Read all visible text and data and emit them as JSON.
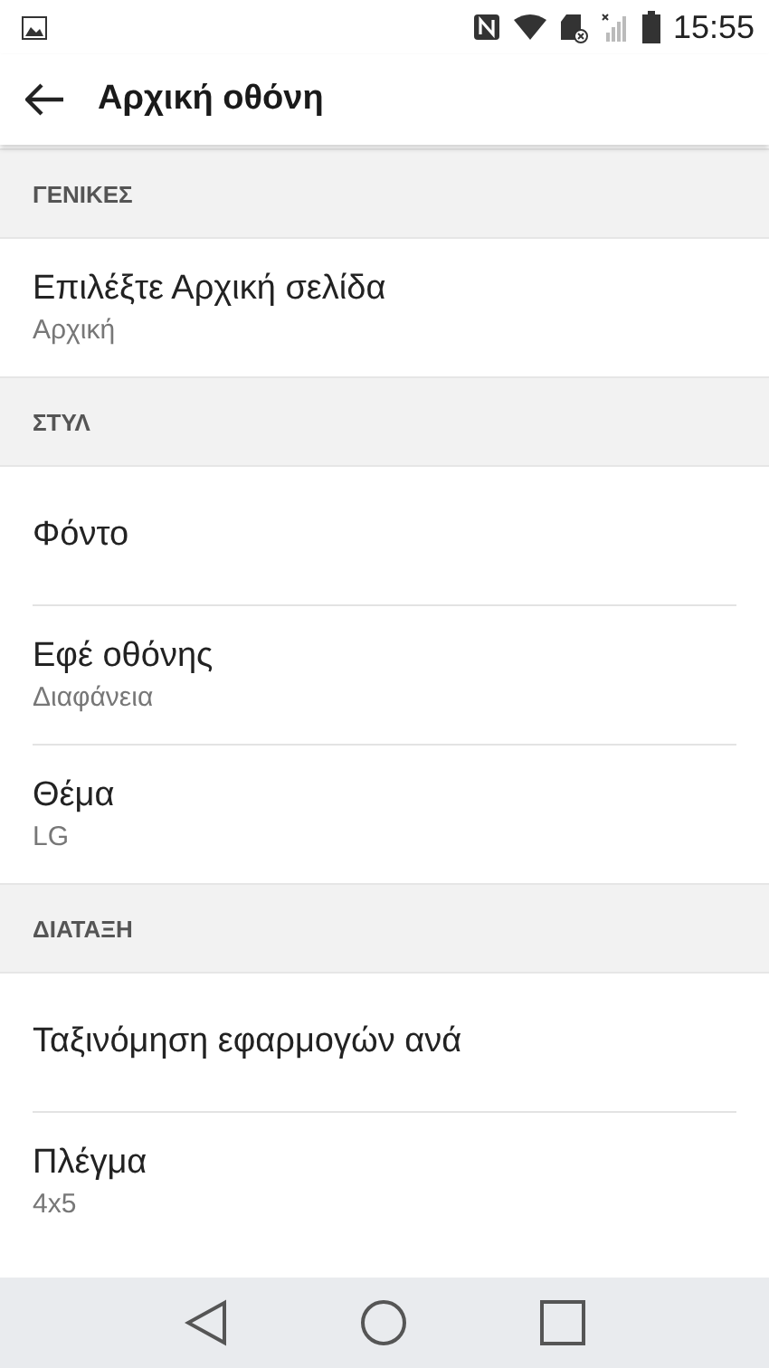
{
  "status_bar": {
    "time": "15:55"
  },
  "header": {
    "title": "Αρχική οθόνη"
  },
  "sections": [
    {
      "title": "ΓΕΝΙΚΕΣ",
      "items": [
        {
          "title": "Επιλέξτε Αρχική σελίδα",
          "subtitle": "Αρχική"
        }
      ]
    },
    {
      "title": "ΣΤΥΛ",
      "items": [
        {
          "title": "Φόντο"
        },
        {
          "title": "Εφέ οθόνης",
          "subtitle": "Διαφάνεια"
        },
        {
          "title": "Θέμα",
          "subtitle": "LG"
        }
      ]
    },
    {
      "title": "ΔΙΑΤΑΞΗ",
      "items": [
        {
          "title": "Ταξινόμηση εφαρμογών ανά"
        },
        {
          "title": "Πλέγμα",
          "subtitle": "4x5"
        }
      ]
    }
  ]
}
